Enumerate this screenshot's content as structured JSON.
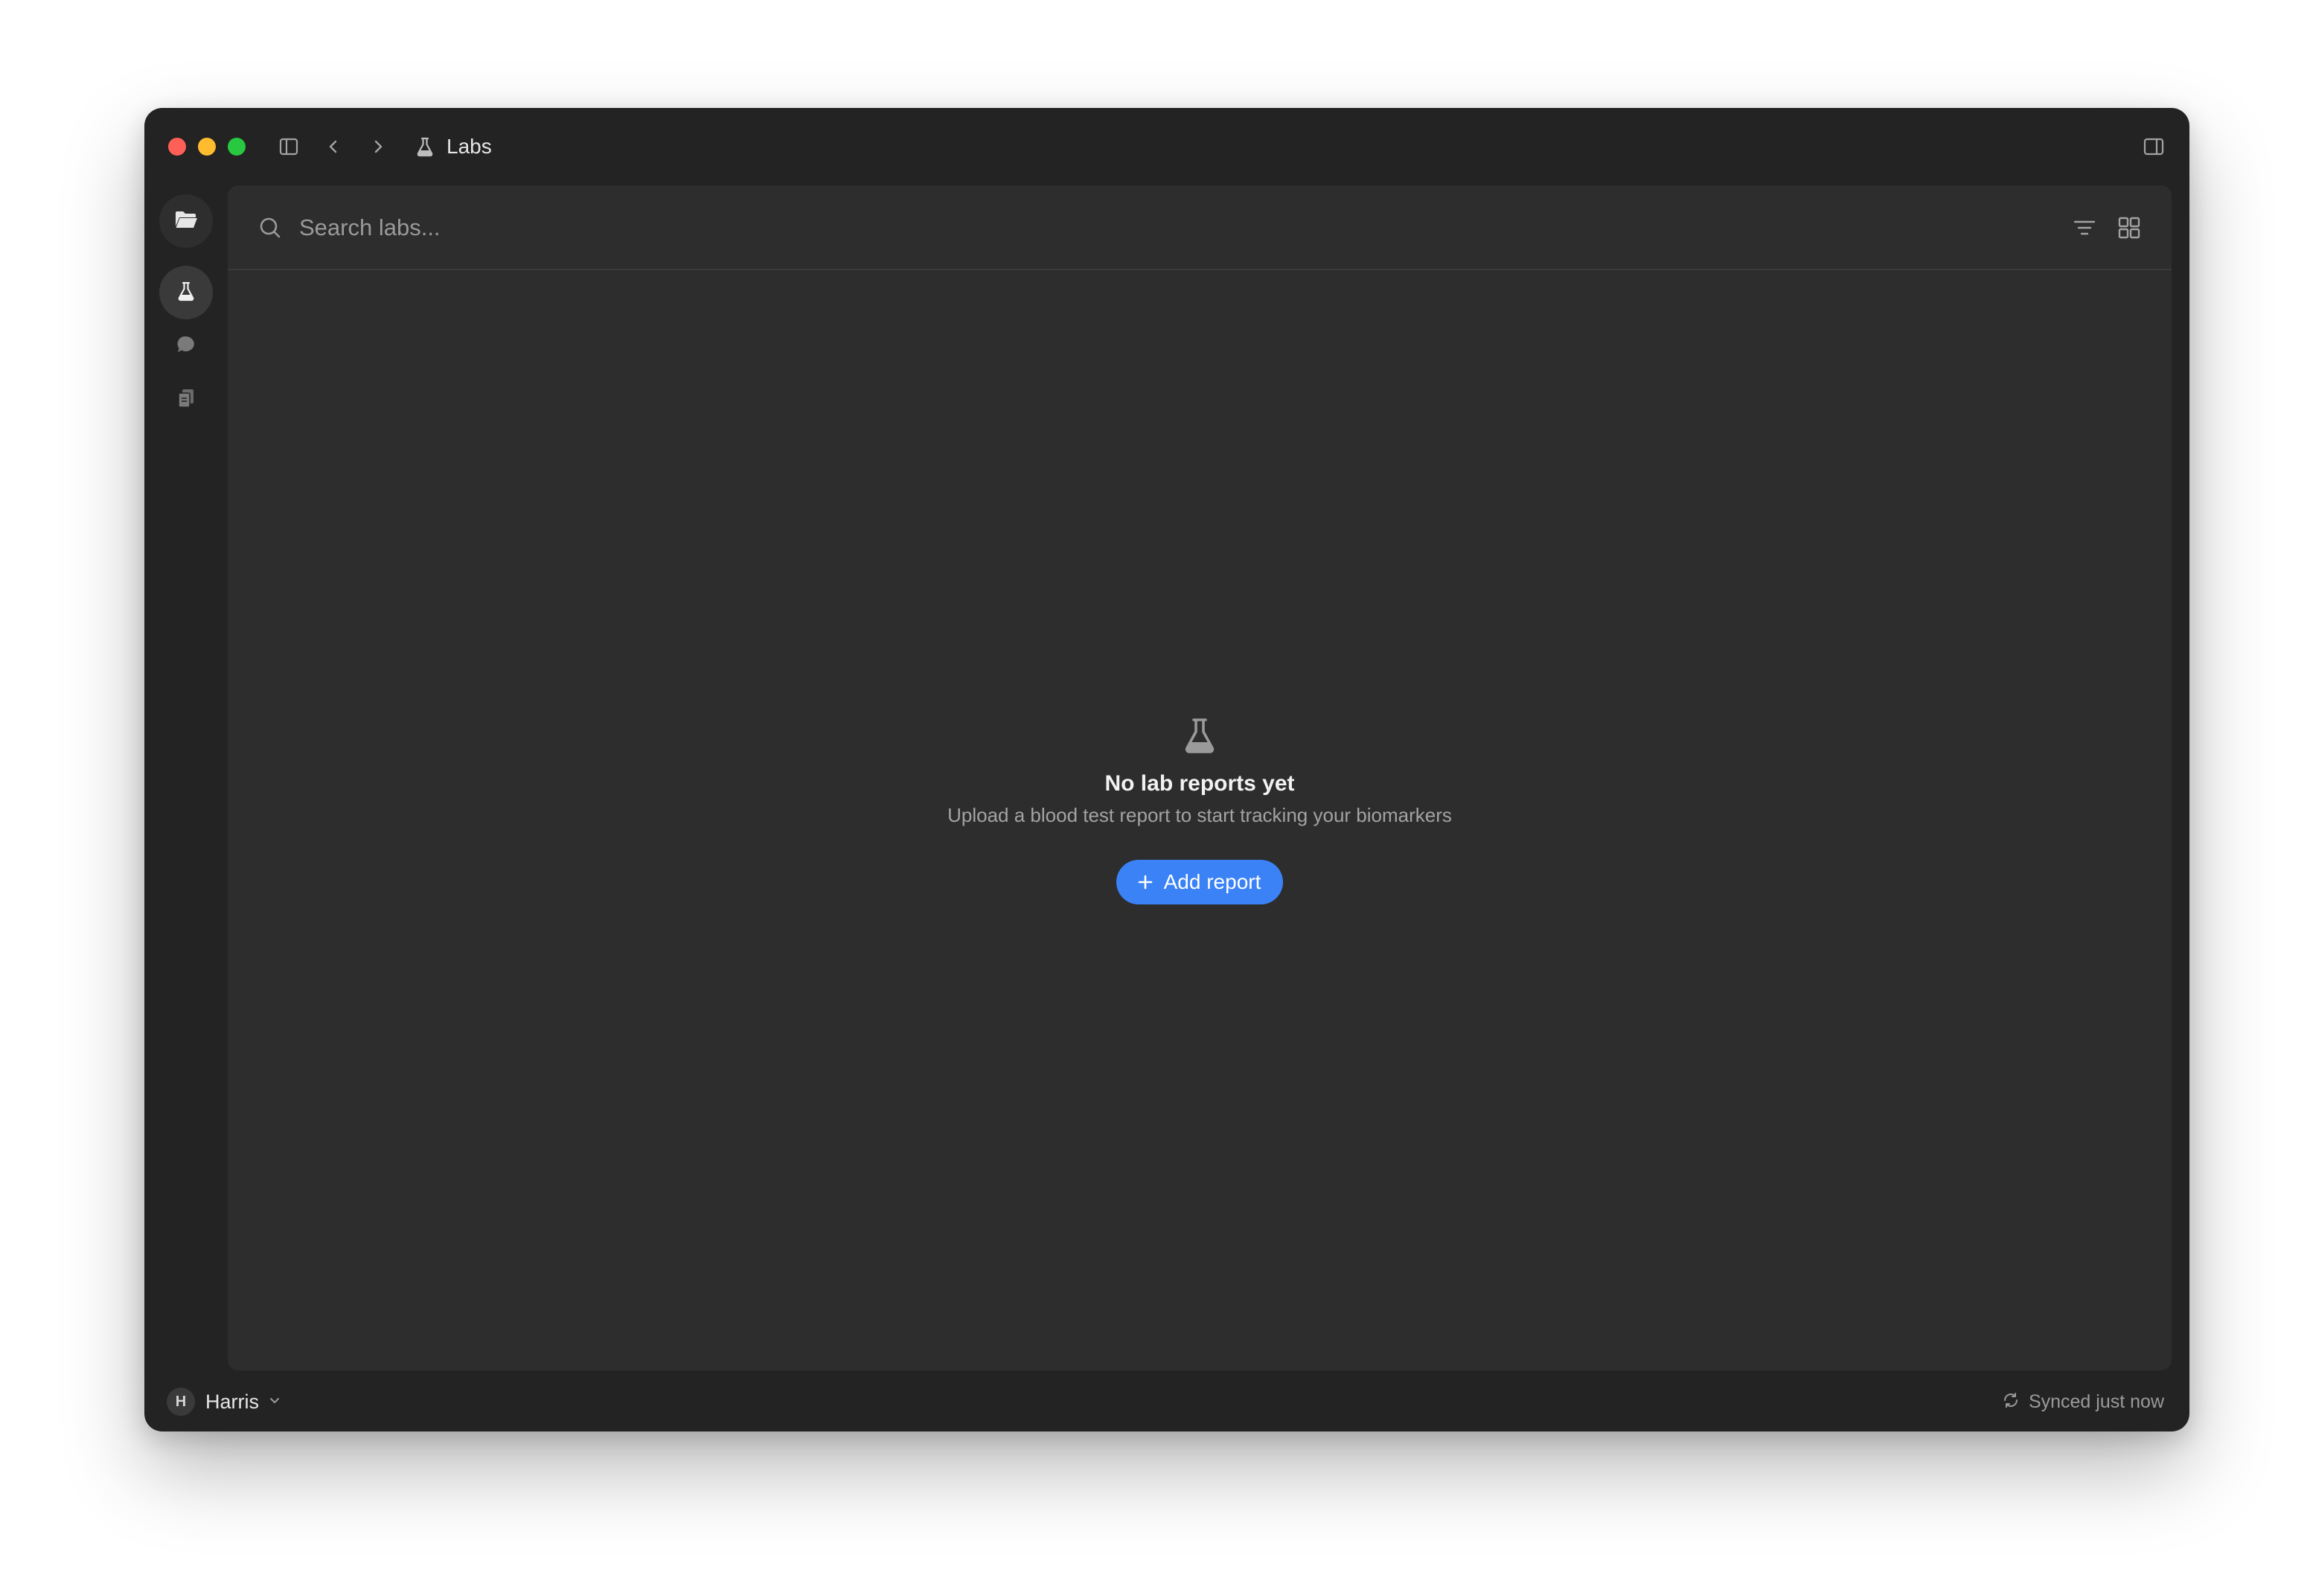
{
  "titlebar": {
    "title": "Labs",
    "icons": [
      "sidebar-toggle-icon",
      "chevron-left-icon",
      "chevron-right-icon",
      "flask-icon",
      "right-panel-icon"
    ]
  },
  "rail": {
    "items": [
      {
        "name": "folder-icon",
        "active": false
      },
      {
        "name": "flask-icon",
        "active": true
      },
      {
        "name": "chat-bubble-icon",
        "active": false
      },
      {
        "name": "documents-icon",
        "active": false
      }
    ]
  },
  "search": {
    "placeholder": "Search labs...",
    "value": ""
  },
  "empty_state": {
    "title": "No lab reports yet",
    "subtitle": "Upload a blood test report to start tracking your biomarkers",
    "button_label": "Add report"
  },
  "footer": {
    "user_initial": "H",
    "user_name": "Harris",
    "sync_status": "Synced just now"
  },
  "colors": {
    "window_bg": "#232323",
    "panel_bg": "#2d2d2d",
    "accent": "#3b82f6",
    "close": "#fe5f57",
    "minimize": "#febc2e",
    "maximize": "#28c840"
  }
}
